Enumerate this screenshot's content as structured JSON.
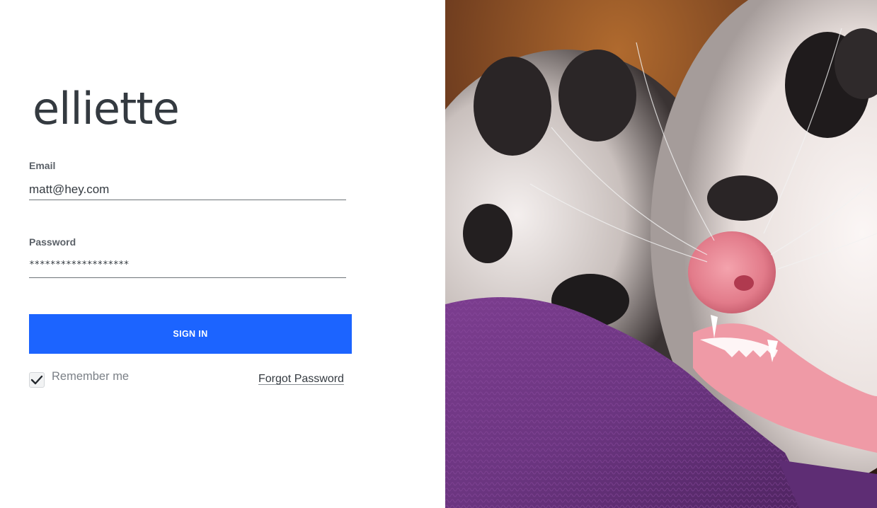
{
  "brand": {
    "logo_text": "elliette"
  },
  "form": {
    "email": {
      "label": "Email",
      "value": "matt@hey.com"
    },
    "password": {
      "label": "Password",
      "masked_value": "*******************"
    },
    "signin_label": "SIGN IN",
    "remember": {
      "label": "Remember me",
      "checked": true
    },
    "forgot_label": "Forgot Password"
  },
  "hero": {
    "icon": "opossum-photo"
  },
  "colors": {
    "accent": "#1c64ff",
    "text": "#343a40",
    "label": "#5b6168",
    "muted": "#7b8087",
    "blanket": "#6b3580"
  }
}
